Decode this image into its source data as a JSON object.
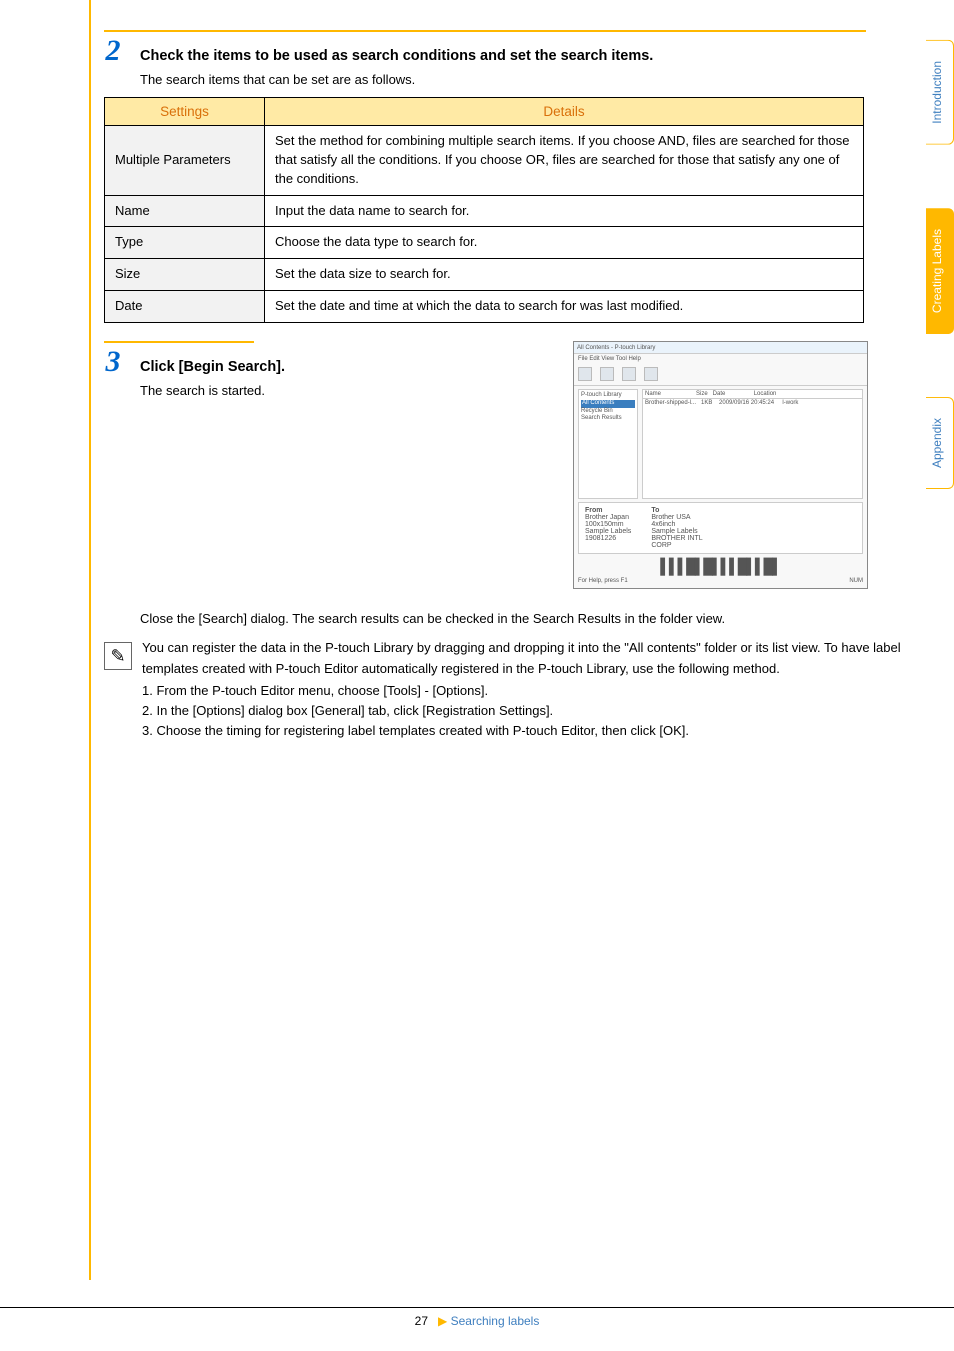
{
  "sideTabs": {
    "intro": "Introduction",
    "creating": "Creating Labels",
    "appendix": "Appendix"
  },
  "step2": {
    "title": "Check the items to be used as search conditions and set the search items.",
    "sub": "The search items that can be set are as follows."
  },
  "table": {
    "hSettings": "Settings",
    "hDetails": "Details",
    "rows": [
      {
        "label": "Multiple Parameters",
        "detail": "Set the method for combining multiple search items. If you choose AND, files are searched for those that satisfy all the conditions. If you choose OR, files are searched for those that satisfy any one of the conditions."
      },
      {
        "label": "Name",
        "detail": "Input the data name to search for."
      },
      {
        "label": "Type",
        "detail": "Choose the data type to search for."
      },
      {
        "label": "Size",
        "detail": "Set the data size to search for."
      },
      {
        "label": "Date",
        "detail": "Set the date and time at which the data to search for was last modified."
      }
    ]
  },
  "step3": {
    "title": "Click [Begin Search].",
    "sub": "The search is started."
  },
  "thumb": {
    "title": "All Contents - P-touch Library",
    "menu": "File  Edit  View  Tool  Help",
    "tree0": "P-touch Library",
    "tree1": "All Contents",
    "tree2": "Recycle Bin",
    "tree3": "Search Results",
    "cols": "Name                     Size   Date                 Location",
    "row": "Brother-shipped-l...   1KB    2009/09/16 20:45:24     l-work",
    "from": "From",
    "fromBody": "Brother Japan\n100x150mm\nSample Labels\n19081226",
    "to": "To",
    "toBody": "Brother USA\n4x6inch\nSample Labels\nBROTHER INTL\nCORP",
    "foot1": "For Help, press F1",
    "foot2": "NUM"
  },
  "postText": "Close the [Search] dialog. The search results can be checked in the Search Results in the folder view.",
  "note": {
    "p1": "You can register the data in the P-touch Library by dragging and dropping it into the \"All contents\" folder or its list view. To have label templates created with P-touch Editor automatically registered in the P-touch Library, use the following method.",
    "l1": "1. From the P-touch Editor menu, choose [Tools] - [Options].",
    "l2": "2. In the [Options] dialog box [General] tab, click [Registration Settings].",
    "l3": "3. Choose the timing for registering label templates created with P-touch Editor, then click [OK]."
  },
  "footer": {
    "page": "27",
    "link": "Searching labels"
  }
}
